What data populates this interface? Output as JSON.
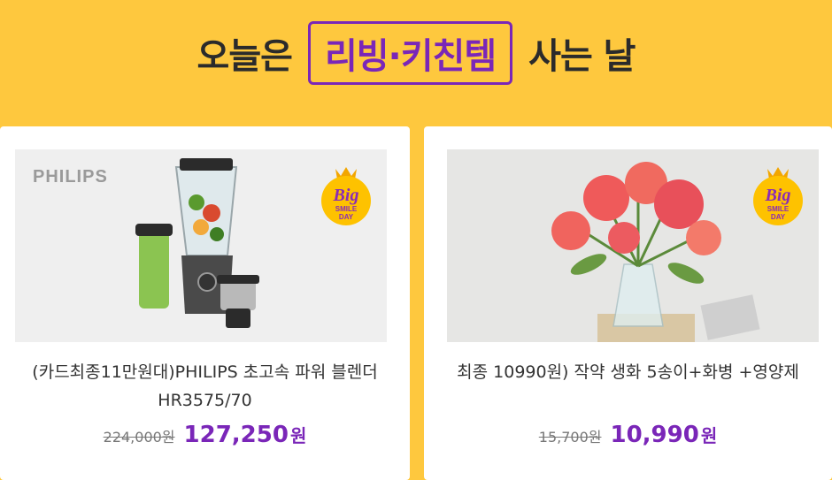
{
  "banner": {
    "prefix": "오늘은",
    "highlight": "리빙·키친템",
    "suffix": "사는 날"
  },
  "products": [
    {
      "brand_text": "PHILIPS",
      "title": "(카드최종11만원대)PHILIPS 초고속 파워 블렌더 HR3575/70",
      "original_price": "224,000원",
      "sale_price": "127,250",
      "currency": "원",
      "badge": {
        "line1": "Big",
        "line2": "SMILE",
        "line3": "DAY"
      }
    },
    {
      "title": "최종 10990원) 작약 생화 5송이+화병 +영양제",
      "original_price": "15,700원",
      "sale_price": "10,990",
      "currency": "원",
      "badge": {
        "line1": "Big",
        "line2": "SMILE",
        "line3": "DAY"
      }
    }
  ],
  "colors": {
    "background": "#fec83e",
    "accent": "#7a26b8",
    "card": "#ffffff"
  }
}
